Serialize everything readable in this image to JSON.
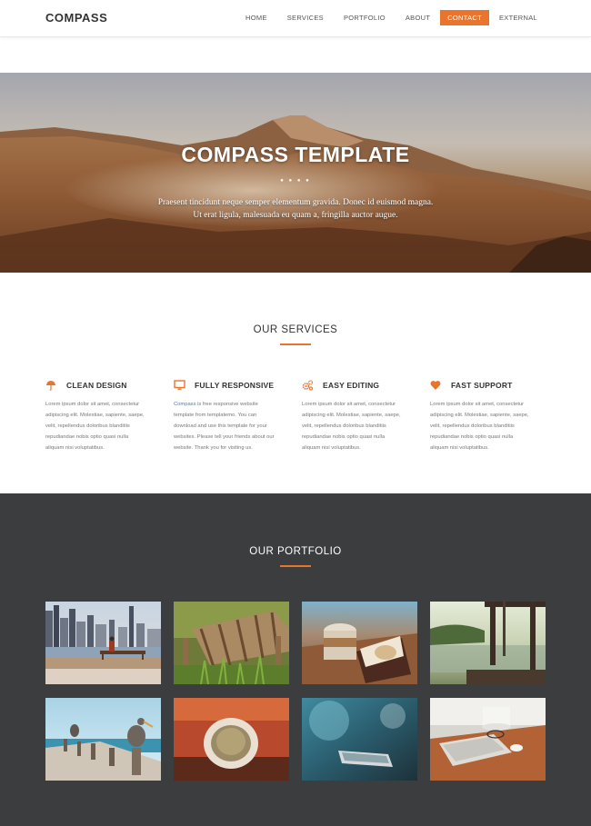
{
  "nav": {
    "brand": "COMPASS",
    "items": [
      {
        "label": "HOME"
      },
      {
        "label": "SERVICES"
      },
      {
        "label": "PORTFOLIO"
      },
      {
        "label": "ABOUT"
      },
      {
        "label": "CONTACT",
        "active": true
      },
      {
        "label": "EXTERNAL"
      }
    ]
  },
  "hero": {
    "title": "COMPASS TEMPLATE",
    "dots": "● ● ● ●",
    "subtitle_line1": "Praesent tincidunt neque semper elementum gravida. Donec id euismod magna.",
    "subtitle_line2": "Ut erat ligula, malesuada eu quam a, fringilla auctor augue."
  },
  "services": {
    "title": "OUR SERVICES",
    "items": [
      {
        "icon": "umbrella-icon",
        "name": "CLEAN DESIGN",
        "lines": [
          "Lorem ipsum dolor sit amet, consectetur",
          "adipiscing elit. Molestiae, sapiente, saepe,",
          "velit, repellendus doloribus blanditiis",
          "repudiandae nobis optio quasi nulla",
          "aliquam nisi voluptatibus."
        ]
      },
      {
        "icon": "monitor-icon",
        "name": "FULLY RESPONSIVE",
        "link": "Compass",
        "lines": [
          " is free responsive website",
          "template from templatemo. You can",
          "download and use this template for your",
          "websites. Please tell your friends about our",
          "website. Thank you for visiting us."
        ]
      },
      {
        "icon": "cogs-icon",
        "name": "EASY EDITING",
        "lines": [
          "Lorem ipsum dolor sit amet, consectetur",
          "adipiscing elit. Molestiae, sapiente, saepe,",
          "velit, repellendus doloribus blanditiis",
          "repudiandae nobis optio quasi nulla",
          "aliquam nisi voluptatibus."
        ]
      },
      {
        "icon": "heart-icon",
        "name": "FAST SUPPORT",
        "lines": [
          "Lorem ipsum dolor sit amet, consectetur",
          "adipiscing elit. Molestiae, sapiente, saepe,",
          "velit, repellendus doloribus blanditiis",
          "repudiandae nobis optio quasi nulla",
          "aliquam nisi voluptatibus."
        ]
      }
    ]
  },
  "portfolio": {
    "title": "OUR PORTFOLIO"
  },
  "colors": {
    "accent": "#e8742d",
    "dark_bg": "#3c3d3f",
    "link": "#3b86c6"
  }
}
